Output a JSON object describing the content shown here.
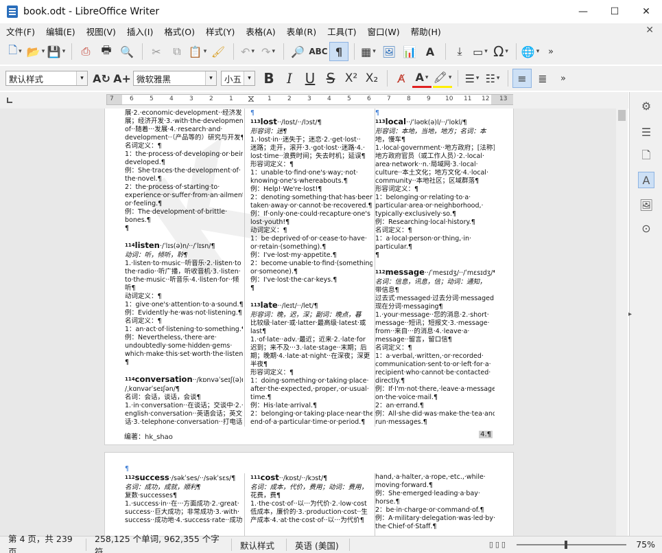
{
  "window": {
    "title": "book.odt - LibreOffice Writer",
    "minimize": "—",
    "maximize": "☐",
    "close": "✕"
  },
  "menu": [
    "文件(F)",
    "编辑(E)",
    "视图(V)",
    "插入(I)",
    "格式(O)",
    "样式(Y)",
    "表格(A)",
    "表单(R)",
    "工具(T)",
    "窗口(W)",
    "帮助(H)"
  ],
  "toolbar": {
    "paragraph_style": "默认样式",
    "font_name": "微软雅黑",
    "font_size": "小五"
  },
  "ruler": {
    "left_numbers": [
      "7",
      "6",
      "5",
      "4",
      "3",
      "2",
      "1"
    ],
    "right_numbers": [
      "1",
      "2",
      "3",
      "4",
      "5",
      "6",
      "7",
      "8",
      "9",
      "10",
      "11",
      "12",
      "13"
    ]
  },
  "page1": {
    "col1": [
      "展·2.·economic·development··经济发",
      "展；经济开发·3.·with·the·development",
      "of··随着···发展·4.·research·and·",
      "development··（产品等的）研究与开发¶",
      "名词定义：¶",
      "1：the·process·of·developing·or·being",
      "developed.¶",
      "例：She·traces·the·development·of·",
      "the·novel.¶",
      "2：the·process·of·starting·to·",
      "experience·or·suffer·from·an·ailment",
      "or·feeling.¶",
      "例：The·development·of·brittle·",
      "bones.¶",
      "¶"
    ],
    "col1_entries": [
      {
        "num": "114",
        "word": "listen",
        "phon": "·/ˈlɪs(ə)n/··/ˈlɪsn/¶",
        "lines": [
          "动词：听，倾听，聆¶",
          "1.·listen·to·music··听音乐·2.·listen·to",
          "the·radio··听广播，听收音机·3.·listen·",
          "to·the·music··听音乐·4.·listen·for··倾",
          "听¶",
          "动词定义：¶",
          "1：give·one's·attention·to·a·sound.¶",
          "例：Evidently·he·was·not·listening.¶",
          "名词定义：¶",
          "1：an·act·of·listening·to·something.¶",
          "例：Nevertheless,·there·are·",
          "undoubtedly·some·hidden·gems·",
          "which·make·this·set·worth·the·listen.¶",
          "¶"
        ]
      },
      {
        "num": "114",
        "word": "conversation",
        "phon": "··/kɒnvəˈseɪʃ(ə)n/··",
        "lines": [
          "/ˌkɑnvərˈseɪʃən/¶",
          "名词：会话，谈话，会谈¶",
          "1.·in·conversation··在谈话；交谈中·2.·",
          "english·conversation··英语会话；英文会",
          "话·3.·telephone·conversation··打电话·",
          "4.·man-machine·conversation··人机对",
          "话¶"
        ]
      }
    ],
    "col2_entries": [
      {
        "num": "113",
        "word": "lost",
        "phon": "··/lɒst/··/lɔst/¶",
        "lines": [
          "形容词：迷¶",
          "1.·lost·in··迷失于；迷恋·2.·get·lost··",
          "迷路；走开，滚开·3.·got·lost··迷路·4.·",
          "lost·time··浪费时间；失去时机；延误¶",
          "形容词定义：¶",
          "1：unable·to·find·one's·way;·not·",
          "knowing·one's·whereabouts.¶",
          "例：Help!·We're·lost!¶",
          "2：denoting·something·that·has·been",
          "taken·away·or·cannot·be·recovered.¶",
          "例：If·only·one·could·recapture·one's",
          "lost·youth!¶",
          "动词定义：¶",
          "1：be·deprived·of·or·cease·to·have·",
          "or·retain·(something).¶",
          "例：I've·lost·my·appetite.¶",
          "2：become·unable·to·find·(something",
          "or·someone).¶",
          "例：I've·lost·the·car·keys.¶",
          "¶"
        ]
      },
      {
        "num": "113",
        "word": "late",
        "phon": "··/leɪt/··/let/¶",
        "lines": [
          "形容词：晚，迟，深；副词：晚点，暮",
          "比较级·later·或·latter·最高级·latest·或",
          "last¶",
          "1.·of·late··adv.·最近；近来·2.·late·for",
          "迟到；来不及···3.·late·stage··末期；后",
          "期；晚期·4.·late·at·night··在深夜；深更",
          "半夜¶",
          "形容词定义：¶",
          "1：doing·something·or·taking·place·",
          "after·the·expected,·proper,·or·usual·",
          "time.¶",
          "例：His·late·arrival.¶",
          "2：belonging·or·taking·place·near·the",
          "end·of·a·particular·time·or·period.¶"
        ]
      }
    ],
    "col3_entries": [
      {
        "num": "113",
        "word": "local",
        "phon": "··/ˈləʊk(ə)l/··/ˈlokl/¶",
        "lines": [
          "形容词：本地，当地，地方；名词：本",
          "地，慢车¶",
          "1.·local·government··地方政府；[法称]",
          "地方政府官员（或工作人员）·2.·local·",
          "area·network··n.·局域网·3.·local·",
          "culture··本土文化；地方文化·4.·local·",
          "community··本地社区；区域群落¶",
          "形容词定义：¶",
          "1：belonging·or·relating·to·a·",
          "particular·area·or·neighborhood,·",
          "typically·exclusively·so.¶",
          "例：Researching·local·history.¶",
          "名词定义：¶",
          "1：a·local·person·or·thing,·in·",
          "particular.¶",
          "¶"
        ]
      },
      {
        "num": "112",
        "word": "message",
        "phon": "··/ˈmesɪdʒ/··/ˈmɛsɪdʒ/¶",
        "lines": [
          "名词：信息，讯息，信；动词：通知，",
          "带信息¶",
          "过去式·messaged·过去分词·messaged·",
          "现在分词·messaging¶",
          "1.·your·message··您的消息·2.·short·",
          "message··短讯；短报文·3.·message·",
          "from··来自···的消息·4.·leave·a·",
          "message··留言，留口信¶",
          "名词定义：¶",
          "1：a·verbal,·written,·or·recorded·",
          "communication·sent·to·or·left·for·a·",
          "recipient·who·cannot·be·contacted·",
          "directly.¶",
          "例：If·I'm·not·there,·leave·a·message",
          "on·the·voice·mail.¶",
          "2：an·errand.¶",
          "例：All·she·did·was·make·the·tea·and",
          "run·messages.¶"
        ]
      }
    ],
    "footer": "编著：hk_shao",
    "page_number": "4.¶"
  },
  "page2": {
    "col1_entries": [
      {
        "num": "112",
        "word": "success",
        "phon": "·/səkˈses/··/səkˈsɛs/¶",
        "lines": [
          "名词：成功，成就，顺利¶",
          "复数·successes¶",
          "1.·success·in··在···方面成功·2.·great·",
          "success··巨大成功；非常成功·3.·with·",
          "success··成功地·4.·success·rate··成功"
        ]
      }
    ],
    "col2_entries": [
      {
        "num": "111",
        "word": "cost",
        "phon": "··/kɒst/··/kɔst/¶",
        "lines": [
          "名词：成本，代价，费用；动词：费用，",
          "花费，费¶",
          "1.·the·cost·of··以···为代价·2.·low·cost",
          "低成本，廉价的·3.·production·cost··生",
          "产成本·4.·at·the·cost·of··以···为代价¶"
        ]
      }
    ],
    "col3": [
      "hand,·a·halter,·a·rope,·etc.,·while·",
      "moving·forward.¶",
      "例：She·emerged·leading·a·bay·",
      "horse.¶",
      "2：be·in·charge·or·command·of.¶",
      "例：A·military·delegation·was·led·by·",
      "the·Chief·of·Staff.¶"
    ]
  },
  "status": {
    "page": "第 4 页，共 239 页",
    "words": "258,125 个单词, 962,355 个字符",
    "style": "默认样式",
    "language": "英语 (美国)",
    "zoom": "75%"
  },
  "colors": {
    "chrome": "#f0f0f0",
    "accent": "#cde0f5",
    "doc_bg": "#e8e8e8"
  }
}
